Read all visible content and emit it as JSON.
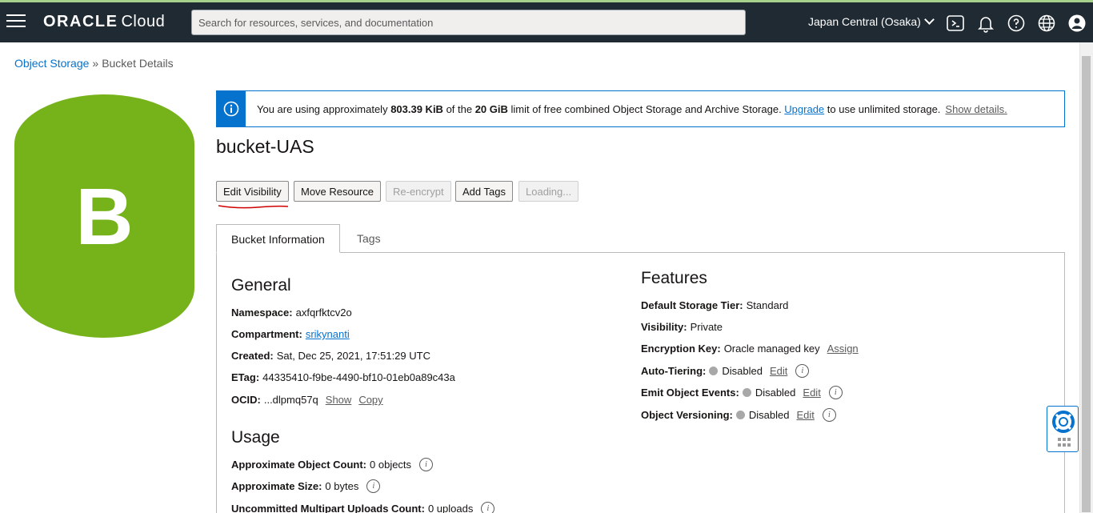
{
  "header": {
    "brand_oracle": "ORACLE",
    "brand_cloud": "Cloud",
    "search_placeholder": "Search for resources, services, and documentation",
    "region": "Japan Central (Osaka)",
    "icons": [
      "menu-icon",
      "cloud-shell-icon",
      "bell-icon",
      "help-icon",
      "globe-icon",
      "user-icon"
    ]
  },
  "breadcrumb": {
    "parent": "Object Storage",
    "separator": "»",
    "current": "Bucket Details"
  },
  "bucket_badge": {
    "letter": "B",
    "color": "#76b31b"
  },
  "banner": {
    "prefix": "You are using approximately ",
    "used": "803.39 KiB",
    "middle": " of the ",
    "limit": "20 GiB",
    "suffix": " limit of free combined Object Storage and Archive Storage. ",
    "upgrade": "Upgrade",
    "after_upgrade": " to use unlimited storage.",
    "show_details": "Show details."
  },
  "title": "bucket-UAS",
  "actions": [
    {
      "label": "Edit Visibility",
      "enabled": true
    },
    {
      "label": "Move Resource",
      "enabled": true
    },
    {
      "label": "Re-encrypt",
      "enabled": false
    },
    {
      "label": "Add Tags",
      "enabled": true
    },
    {
      "label": "Loading...",
      "enabled": false
    }
  ],
  "tabs": [
    {
      "label": "Bucket Information",
      "active": true
    },
    {
      "label": "Tags",
      "active": false
    }
  ],
  "general": {
    "heading": "General",
    "namespace_label": "Namespace:",
    "namespace": "axfqrfktcv2o",
    "compartment_label": "Compartment:",
    "compartment": "srikynanti",
    "created_label": "Created:",
    "created": "Sat, Dec 25, 2021, 17:51:29 UTC",
    "etag_label": "ETag:",
    "etag": "44335410-f9be-4490-bf10-01eb0a89c43a",
    "ocid_label": "OCID:",
    "ocid": "...dlpmq57q",
    "show": "Show",
    "copy": "Copy"
  },
  "usage": {
    "heading": "Usage",
    "object_count_label": "Approximate Object Count:",
    "object_count": "0 objects",
    "size_label": "Approximate Size:",
    "size": "0 bytes",
    "multipart_label": "Uncommitted Multipart Uploads Count:",
    "multipart": "0 uploads"
  },
  "features": {
    "heading": "Features",
    "tier_label": "Default Storage Tier:",
    "tier": "Standard",
    "visibility_label": "Visibility:",
    "visibility": "Private",
    "encryption_label": "Encryption Key:",
    "encryption": "Oracle managed key",
    "assign": "Assign",
    "autotiering_label": "Auto-Tiering:",
    "autotiering": "Disabled",
    "events_label": "Emit Object Events:",
    "events": "Disabled",
    "versioning_label": "Object Versioning:",
    "versioning": "Disabled",
    "edit": "Edit"
  },
  "colors": {
    "topbar": "#1f2a33",
    "accent": "#0572ce",
    "bucket_green": "#76b31b",
    "annotation_red": "#d00000"
  }
}
